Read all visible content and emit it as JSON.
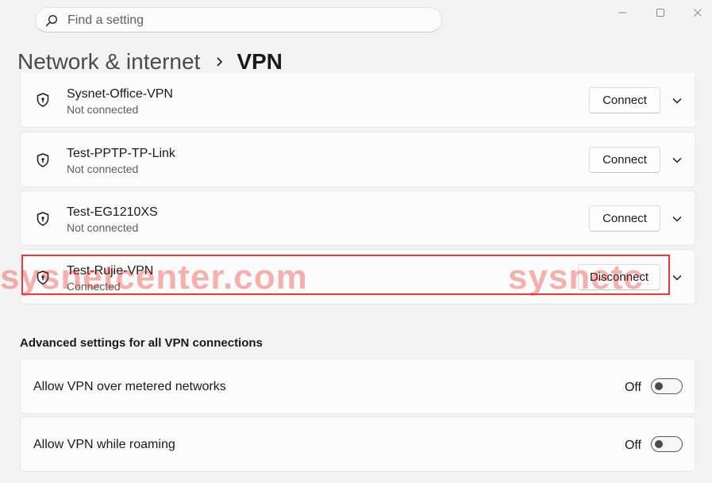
{
  "search": {
    "placeholder": "Find a setting"
  },
  "breadcrumb": {
    "parent": "Network & internet",
    "current": "VPN"
  },
  "vpn_connections": [
    {
      "name": "Sysnet-Office-VPN",
      "status": "Not connected",
      "action": "Connect"
    },
    {
      "name": "Test-PPTP-TP-Link",
      "status": "Not connected",
      "action": "Connect"
    },
    {
      "name": "Test-EG1210XS",
      "status": "Not connected",
      "action": "Connect"
    },
    {
      "name": "Test-Rujie-VPN",
      "status": "Connected",
      "action": "Disconnect"
    }
  ],
  "watermark": {
    "left": "sysnetcenter.com",
    "right": "sysnetc"
  },
  "advanced": {
    "title": "Advanced settings for all VPN connections",
    "settings": [
      {
        "label": "Allow VPN over metered networks",
        "state": "Off"
      },
      {
        "label": "Allow VPN while roaming",
        "state": "Off"
      }
    ]
  },
  "colors": {
    "highlight": "#e53b3b",
    "watermark": "#e61414",
    "background": "#f3f3f3"
  },
  "icons": {
    "search": "search-icon",
    "vpn": "shield-icon",
    "expand": "chevron-down-icon"
  }
}
